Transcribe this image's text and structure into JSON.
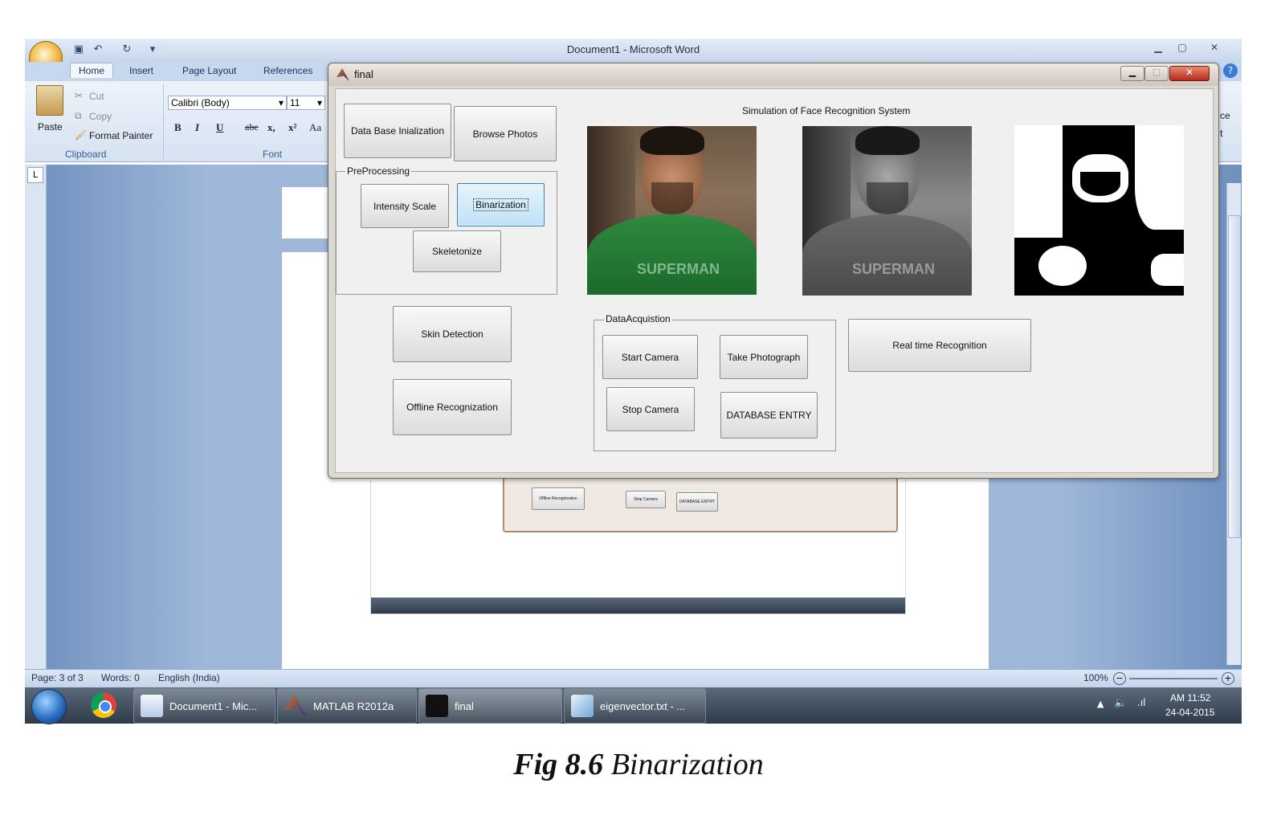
{
  "word": {
    "title": "Document1 - Microsoft Word",
    "tabs": [
      "Home",
      "Insert",
      "Page Layout",
      "References"
    ],
    "clipboard": {
      "cut": "Cut",
      "copy": "Copy",
      "paste": "Paste",
      "format_painter": "Format Painter",
      "group_label": "Clipboard"
    },
    "font": {
      "family": "Calibri (Body)",
      "size": "11",
      "group_label": "Font",
      "bold": "B",
      "italic": "I",
      "underline": "U",
      "strike": "abe",
      "subscript": "x,",
      "superscript": "x²",
      "change_case": "Aa"
    },
    "right_tabs": [
      "ce",
      "t"
    ],
    "status": {
      "page": "Page: 3 of 3",
      "words": "Words: 0",
      "language": "English (India)",
      "zoom": "100%"
    }
  },
  "figure": {
    "title": "final",
    "sim_title": "Simulation of Face Recognition System",
    "buttons": {
      "db_init": "Data Base Inialization",
      "browse": "Browse Photos",
      "intensity": "Intensity Scale",
      "binarization": "Binarization",
      "skeletonize": "Skeletonize",
      "skin": "Skin Detection",
      "offline": "Offline Recognization",
      "start_cam": "Start Camera",
      "take_photo": "Take Photograph",
      "stop_cam": "Stop Camera",
      "db_entry": "DATABASE ENTRY",
      "realtime": "Real time Recognition"
    },
    "panels": {
      "preprocessing": "PreProcessing",
      "acquisition": "DataAcquistion"
    },
    "images": {
      "shirt_text": "SUPERMAN"
    }
  },
  "embedded": {
    "offline": "Offline Recognization",
    "stop": "Stop Camera",
    "db_entry": "DATABASE ENTRY"
  },
  "taskbar": {
    "items": [
      "Document1 - Mic...",
      "MATLAB R2012a",
      "final",
      "eigenvector.txt - ..."
    ],
    "time": "AM 11:52",
    "date": "24-04-2015"
  },
  "caption": {
    "label": "Fig 8.6",
    "text": "Binarization"
  }
}
